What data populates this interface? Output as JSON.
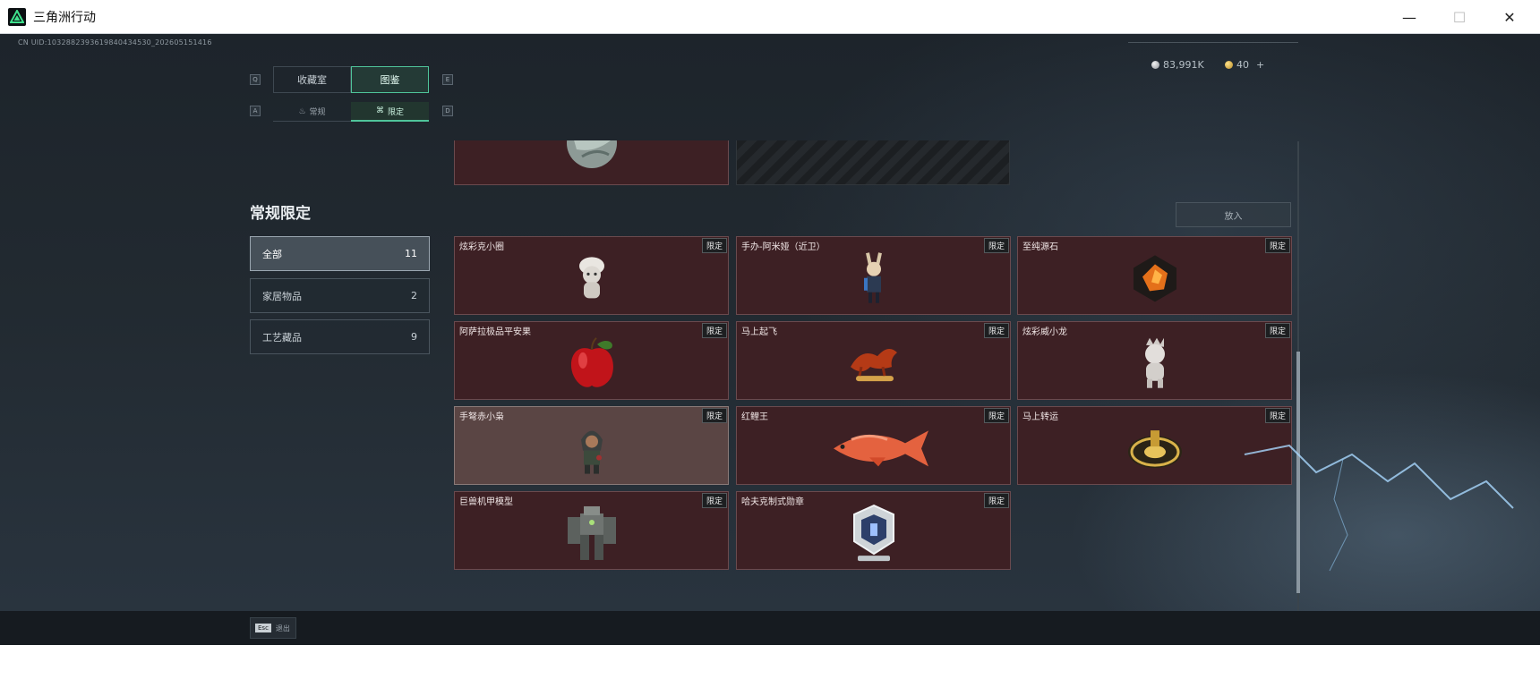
{
  "window": {
    "title": "三角洲行动",
    "min_icon": "—",
    "max_icon": "☐",
    "close_icon": "✕"
  },
  "uid": "CN UID:1032882393619840434530_202605151416",
  "currency": [
    {
      "icon": "silver-coin-icon",
      "value": "83,991K"
    },
    {
      "icon": "gold-coin-icon",
      "value": "40",
      "add": "+"
    }
  ],
  "tabs": {
    "left_key": "Q",
    "right_key": "E",
    "items": [
      {
        "label": "收藏室",
        "active": false
      },
      {
        "label": "图鉴",
        "active": true
      }
    ]
  },
  "subtabs": {
    "left_key": "A",
    "right_key": "D",
    "items": [
      {
        "label": "常规",
        "active": false
      },
      {
        "label": "限定",
        "active": true
      }
    ]
  },
  "section_title": "常规限定",
  "categories": [
    {
      "label": "全部",
      "count": "11",
      "active": true
    },
    {
      "label": "家居物品",
      "count": "2",
      "active": false
    },
    {
      "label": "工艺藏品",
      "count": "9",
      "active": false
    }
  ],
  "put_button": "放入",
  "tag_label": "限定",
  "items": [
    {
      "name": "炫彩克小圈",
      "icon": "plush-doll-icon"
    },
    {
      "name": "手办-阿米娅（近卫）",
      "icon": "figure-icon"
    },
    {
      "name": "至纯源石",
      "icon": "crystal-icon"
    },
    {
      "name": "阿萨拉极品平安果",
      "icon": "apple-icon"
    },
    {
      "name": "马上起飞",
      "icon": "horse-icon"
    },
    {
      "name": "炫彩威小龙",
      "icon": "plush-dragon-icon"
    },
    {
      "name": "手弩赤小枭",
      "icon": "hooded-figure-icon",
      "hover": true
    },
    {
      "name": "红鲤王",
      "icon": "carp-icon"
    },
    {
      "name": "马上转运",
      "icon": "golden-disc-icon"
    },
    {
      "name": "巨兽机甲模型",
      "icon": "mech-icon"
    },
    {
      "name": "哈夫克制式勋章",
      "icon": "medal-icon"
    }
  ],
  "footer": {
    "esc_key": "Esc",
    "esc_label": "退出"
  },
  "colors": {
    "accent": "#4fc49a",
    "card_bg": "#3d2024",
    "card_hover": "#5a4544"
  }
}
